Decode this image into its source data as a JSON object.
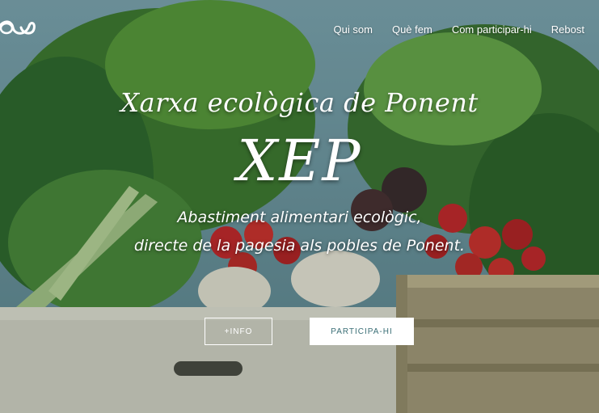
{
  "nav": {
    "items": [
      {
        "label": "Qui som"
      },
      {
        "label": "Què fem"
      },
      {
        "label": "Com participar-hi"
      },
      {
        "label": "Rebost"
      }
    ]
  },
  "hero": {
    "subtitle": "Xarxa ecològica de Ponent",
    "title": "XEP",
    "tagline_line1": "Abastiment alimentari ecològic,",
    "tagline_line2": "directe de la pagesia als pobles de Ponent.",
    "btn_info": "+INFO",
    "btn_participa": "PARTICIPA-HI",
    "image": "vegetable-crates-photo",
    "colors": {
      "accent": "#3a6e76",
      "text": "#ffffff"
    }
  }
}
